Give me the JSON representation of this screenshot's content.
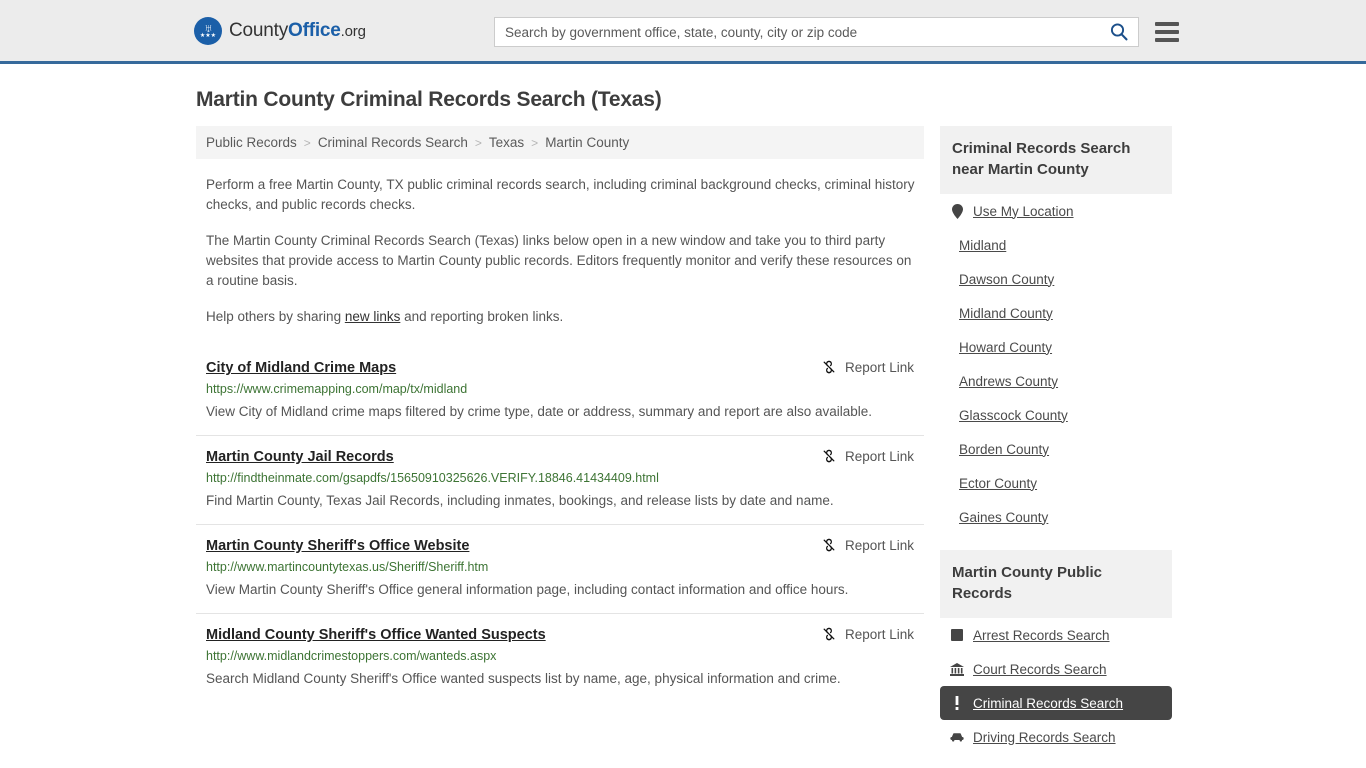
{
  "header": {
    "logo": {
      "name_part1": "County",
      "name_part2": "Office",
      "name_part3": ".org",
      "eagle_glyph": "♅",
      "stars_glyph": "★★★"
    },
    "search": {
      "placeholder": "Search by government office, state, county, city or zip code",
      "value": "",
      "button_icon": "search-icon"
    },
    "menu_icon": "hamburger-menu-icon"
  },
  "page": {
    "title": "Martin County Criminal Records Search (Texas)"
  },
  "breadcrumb": {
    "separator": ">",
    "items": [
      {
        "label": "Public Records"
      },
      {
        "label": "Criminal Records Search"
      },
      {
        "label": "Texas"
      },
      {
        "label": "Martin County"
      }
    ]
  },
  "intro": {
    "paragraph1": "Perform a free Martin County, TX public criminal records search, including criminal background checks, criminal history checks, and public records checks.",
    "paragraph2": "The Martin County Criminal Records Search (Texas) links below open in a new window and take you to third party websites that provide access to Martin County public records. Editors frequently monitor and verify these resources on a routine basis.",
    "paragraph3_pre": "Help others by sharing ",
    "paragraph3_link": "new links",
    "paragraph3_post": " and reporting broken links."
  },
  "report_link_label": "Report Link",
  "results": [
    {
      "title": "City of Midland Crime Maps",
      "url": "https://www.crimemapping.com/map/tx/midland",
      "description": "View City of Midland crime maps filtered by crime type, date or address, summary and report are also available."
    },
    {
      "title": "Martin County Jail Records",
      "url": "http://findtheinmate.com/gsapdfs/15650910325626.VERIFY.18846.41434409.html",
      "description": "Find Martin County, Texas Jail Records, including inmates, bookings, and release lists by date and name."
    },
    {
      "title": "Martin County Sheriff's Office Website",
      "url": "http://www.martincountytexas.us/Sheriff/Sheriff.htm",
      "description": "View Martin County Sheriff's Office general information page, including contact information and office hours."
    },
    {
      "title": "Midland County Sheriff's Office Wanted Suspects",
      "url": "http://www.midlandcrimestoppers.com/wanteds.aspx",
      "description": "Search Midland County Sheriff's Office wanted suspects list by name, age, physical information and crime."
    }
  ],
  "sidebar": {
    "nearby": {
      "heading": "Criminal Records Search near Martin County",
      "items": [
        {
          "label": "Use My Location",
          "icon": "map-pin-icon"
        },
        {
          "label": "Midland",
          "icon": ""
        },
        {
          "label": "Dawson County",
          "icon": ""
        },
        {
          "label": "Midland County",
          "icon": ""
        },
        {
          "label": "Howard County",
          "icon": ""
        },
        {
          "label": "Andrews County",
          "icon": ""
        },
        {
          "label": "Glasscock County",
          "icon": ""
        },
        {
          "label": "Borden County",
          "icon": ""
        },
        {
          "label": "Ector County",
          "icon": ""
        },
        {
          "label": "Gaines County",
          "icon": ""
        }
      ]
    },
    "public_records": {
      "heading": "Martin County Public Records",
      "items": [
        {
          "label": "Arrest Records Search",
          "icon": "fingerprint-icon",
          "active": false
        },
        {
          "label": "Court Records Search",
          "icon": "courthouse-icon",
          "active": false
        },
        {
          "label": "Criminal Records Search",
          "icon": "exclamation-icon",
          "active": true
        },
        {
          "label": "Driving Records Search",
          "icon": "car-icon",
          "active": false
        }
      ]
    }
  },
  "colors": {
    "brand_blue": "#1b5fa8",
    "header_border": "#36699b",
    "header_bg": "#ececec",
    "url_green": "#3d7434",
    "active_bg": "#454545"
  }
}
